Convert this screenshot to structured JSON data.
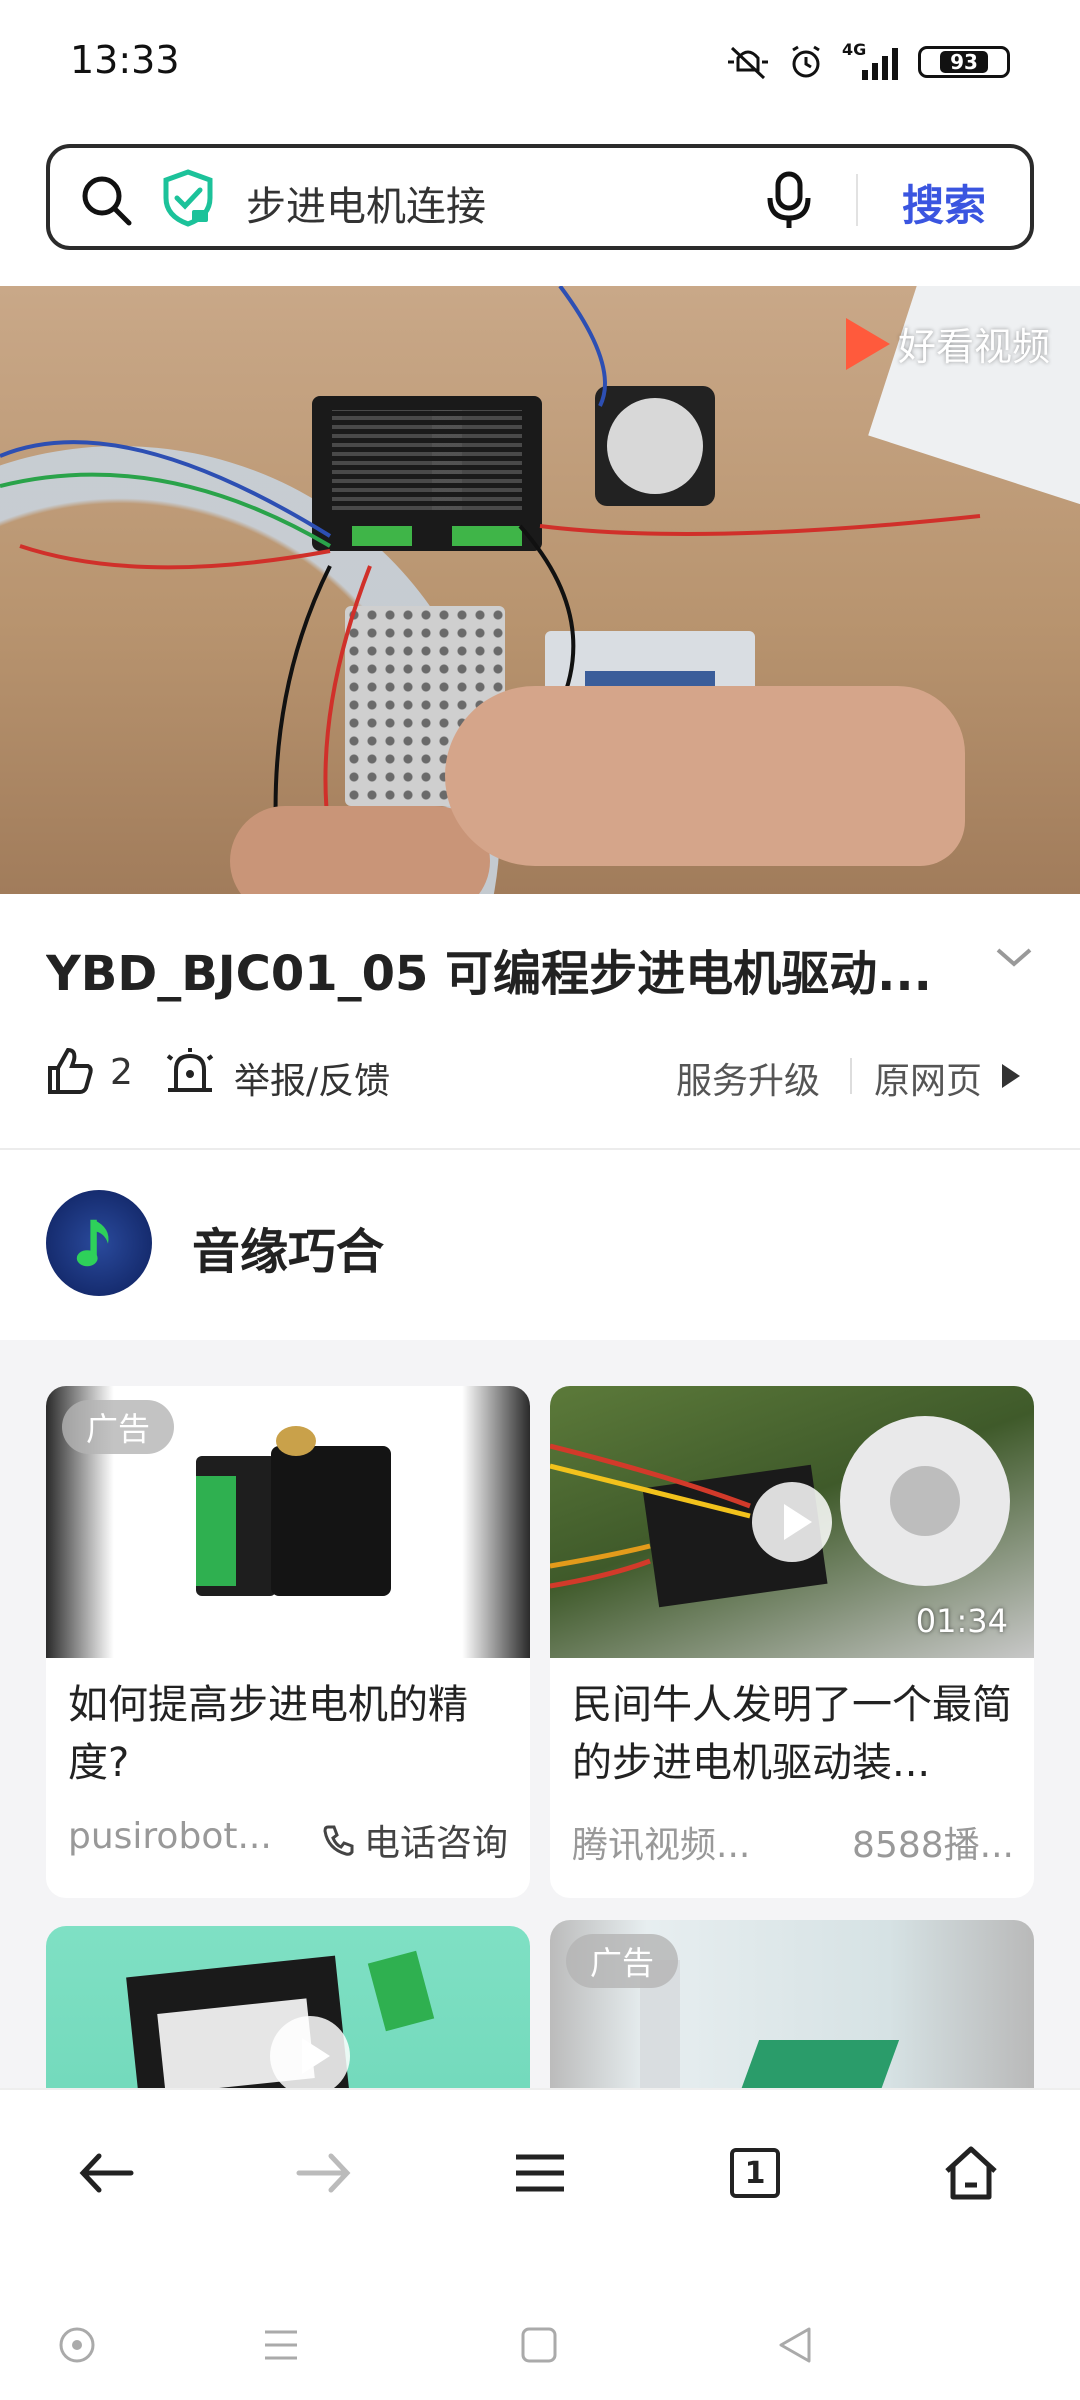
{
  "status_bar": {
    "time": "13:33",
    "network": "4G",
    "battery": "93"
  },
  "search": {
    "query": "步进电机连接",
    "button": "搜索"
  },
  "video": {
    "watermark": "好看视频"
  },
  "detail": {
    "title": "YBD_BJC01_05 可编程步进电机驱动...",
    "like_count": "2",
    "report": "举报/反馈",
    "service_upgrade": "服务升级",
    "original_page": "原网页"
  },
  "channel": {
    "name": "音缘巧合"
  },
  "feed": [
    {
      "badge": "广告",
      "title": "如何提高步进电机的精度?",
      "source": "pusirobot...",
      "action": "电话咨询"
    },
    {
      "duration": "01:34",
      "title": "民间牛人发明了一个最简的步进电机驱动装...",
      "source": "腾讯视频...",
      "meta": "8588播..."
    },
    {
      "title": ""
    },
    {
      "badge": "广告"
    }
  ],
  "bottom_nav": {
    "tab_count": "1"
  },
  "colors": {
    "accent": "#3a55e0",
    "shield": "#1cc29a"
  }
}
